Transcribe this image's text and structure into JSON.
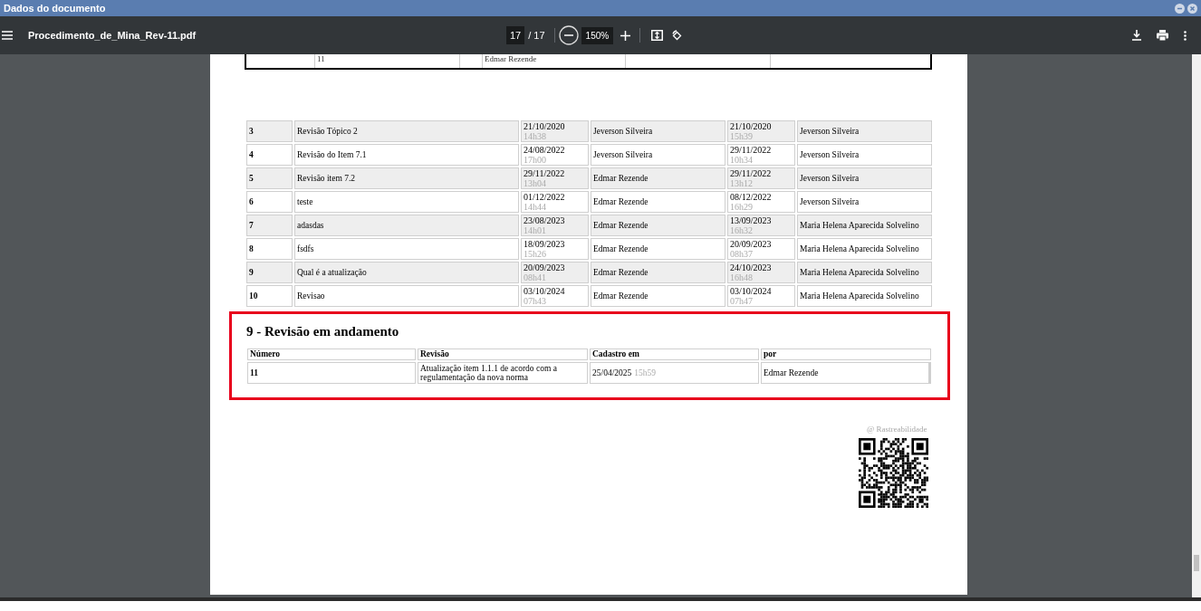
{
  "window": {
    "title": "Dados do documento"
  },
  "toolbar": {
    "file_name": "Procedimento_de_Mina_Rev-11.pdf",
    "page": "17",
    "page_total": "/ 17",
    "zoom": "150%"
  },
  "previous_table": {
    "cells": [
      "",
      "11",
      "",
      "Edmar Rezende",
      "",
      ""
    ]
  },
  "revisions_table": {
    "rows": [
      {
        "shaded": true,
        "number": "3",
        "revision": "Revisão Tópico 2",
        "created_date": "21/10/2020",
        "created_time": "14h38",
        "created_by": "Jeverson Silveira",
        "approved_date": "21/10/2020",
        "approved_time": "15h39",
        "approved_by": "Jeverson Silveira"
      },
      {
        "shaded": false,
        "number": "4",
        "revision": "Revisão do Item 7.1",
        "created_date": "24/08/2022",
        "created_time": "17h00",
        "created_by": "Jeverson Silveira",
        "approved_date": "29/11/2022",
        "approved_time": "10h34",
        "approved_by": "Jeverson Silveira"
      },
      {
        "shaded": true,
        "number": "5",
        "revision": "Revisão item 7.2",
        "created_date": "29/11/2022",
        "created_time": "13h04",
        "created_by": "Edmar Rezende",
        "approved_date": "29/11/2022",
        "approved_time": "13h12",
        "approved_by": "Jeverson Silveira"
      },
      {
        "shaded": false,
        "number": "6",
        "revision": "teste",
        "created_date": "01/12/2022",
        "created_time": "14h44",
        "created_by": "Edmar Rezende",
        "approved_date": "08/12/2022",
        "approved_time": "16h29",
        "approved_by": "Jeverson Silveira"
      },
      {
        "shaded": true,
        "number": "7",
        "revision": "adasdas",
        "created_date": "23/08/2023",
        "created_time": "14h01",
        "created_by": "Edmar Rezende",
        "approved_date": "13/09/2023",
        "approved_time": "16h32",
        "approved_by": "Maria Helena Aparecida Solvelino"
      },
      {
        "shaded": false,
        "number": "8",
        "revision": "fsdfs",
        "created_date": "18/09/2023",
        "created_time": "15h26",
        "created_by": "Edmar Rezende",
        "approved_date": "20/09/2023",
        "approved_time": "08h37",
        "approved_by": "Maria Helena Aparecida Solvelino"
      },
      {
        "shaded": true,
        "number": "9",
        "revision": "Qual é a atualização",
        "created_date": "20/09/2023",
        "created_time": "08h41",
        "created_by": "Edmar Rezende",
        "approved_date": "24/10/2023",
        "approved_time": "16h48",
        "approved_by": "Maria Helena Aparecida Solvelino"
      },
      {
        "shaded": false,
        "number": "10",
        "revision": "Revisao",
        "created_date": "03/10/2024",
        "created_time": "07h43",
        "created_by": "Edmar Rezende",
        "approved_date": "03/10/2024",
        "approved_time": "07h47",
        "approved_by": "Maria Helena Aparecida Solvelino"
      }
    ]
  },
  "in_progress": {
    "heading": "9 - Revisão em andamento",
    "columns": [
      "Número",
      "Revisão",
      "Cadastro em",
      "por"
    ],
    "rows": [
      {
        "number": "11",
        "revision": "Atualização item 1.1.1 de acordo com a regulamentação da nova norma",
        "date": "25/04/2025",
        "time": "15h59",
        "by": "Edmar Rezende"
      }
    ]
  },
  "traceability": {
    "label": "@ Rastreabilidade"
  }
}
